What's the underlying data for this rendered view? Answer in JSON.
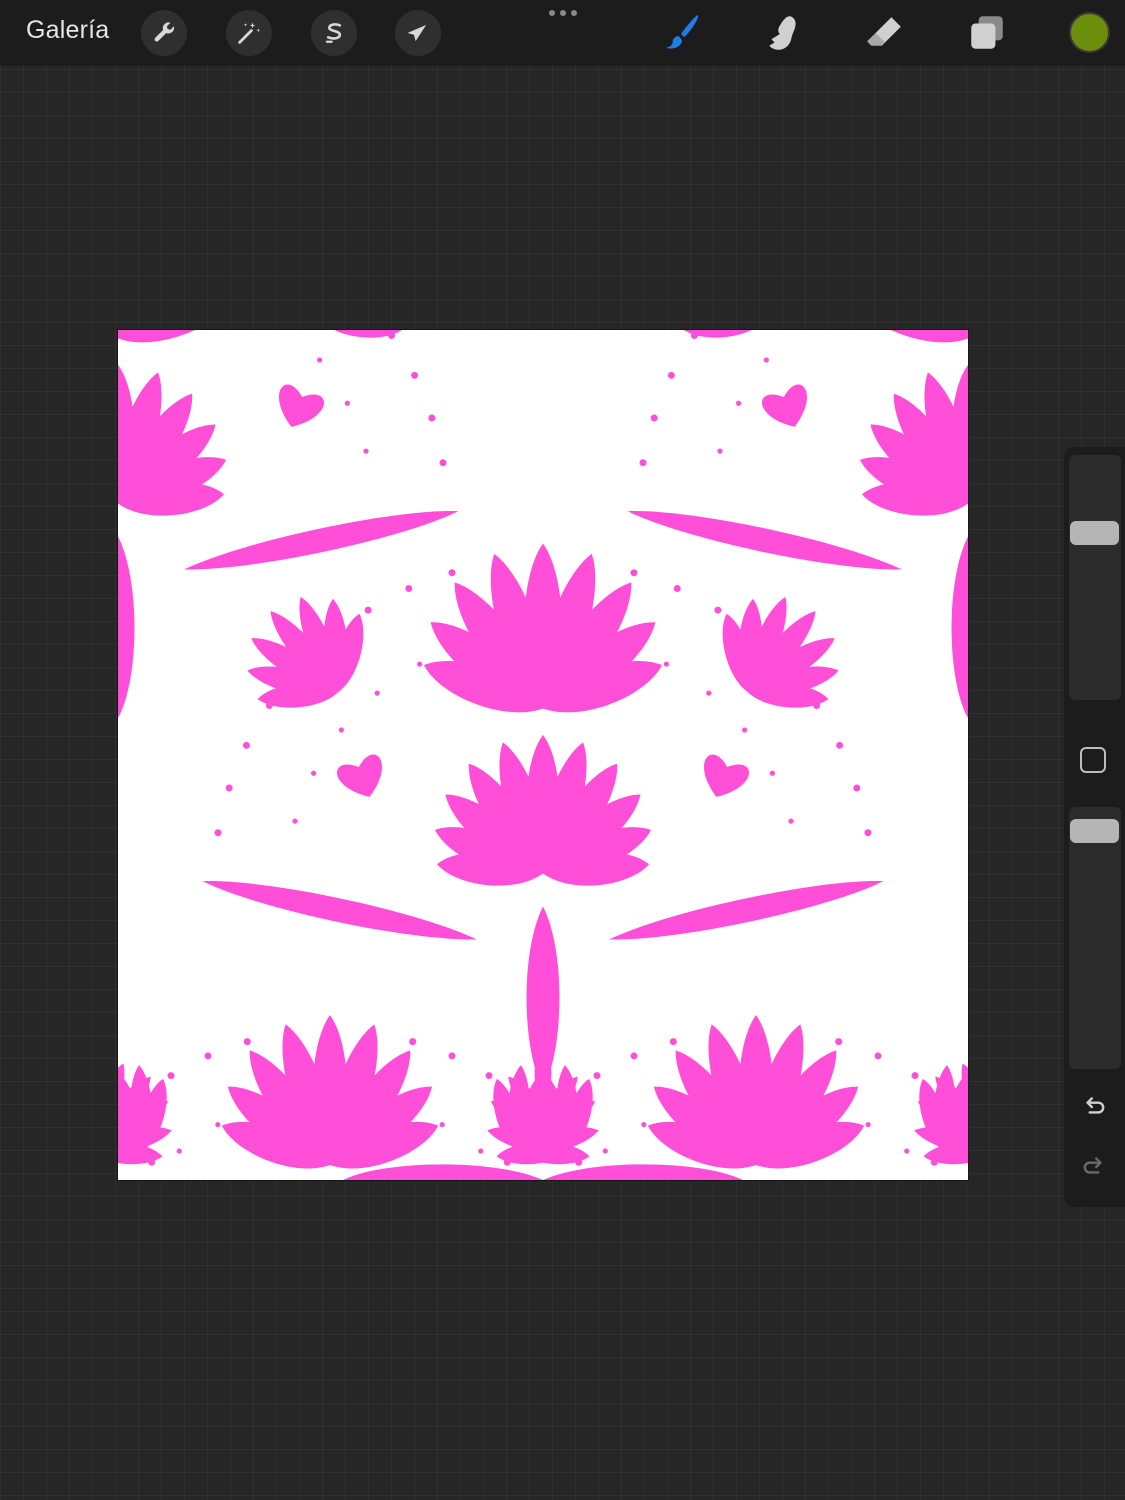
{
  "toolbar": {
    "gallery_label": "Galería",
    "left_tools": [
      {
        "name": "actions",
        "icon": "wrench-icon"
      },
      {
        "name": "adjustments",
        "icon": "magic-wand-icon"
      },
      {
        "name": "selection",
        "icon": "selection-s-icon"
      },
      {
        "name": "transform",
        "icon": "arrow-cursor-icon"
      }
    ],
    "right_tools": [
      {
        "name": "brush",
        "icon": "brush-icon",
        "active": true
      },
      {
        "name": "smudge",
        "icon": "smudge-finger-icon",
        "active": false
      },
      {
        "name": "eraser",
        "icon": "eraser-icon",
        "active": false
      },
      {
        "name": "layers",
        "icon": "layers-icon",
        "active": false
      }
    ],
    "current_color": "#6b8e0d",
    "active_tool_color": "#1f7de8"
  },
  "canvas": {
    "background": "#ffffff",
    "pattern_color": "#ff4fd8"
  },
  "sidebar": {
    "brush_size_level": 0.7,
    "brush_opacity_level": 0.95,
    "modifier_icon": "square-icon",
    "undo_icon": "undo-icon",
    "redo_icon": "redo-icon"
  }
}
